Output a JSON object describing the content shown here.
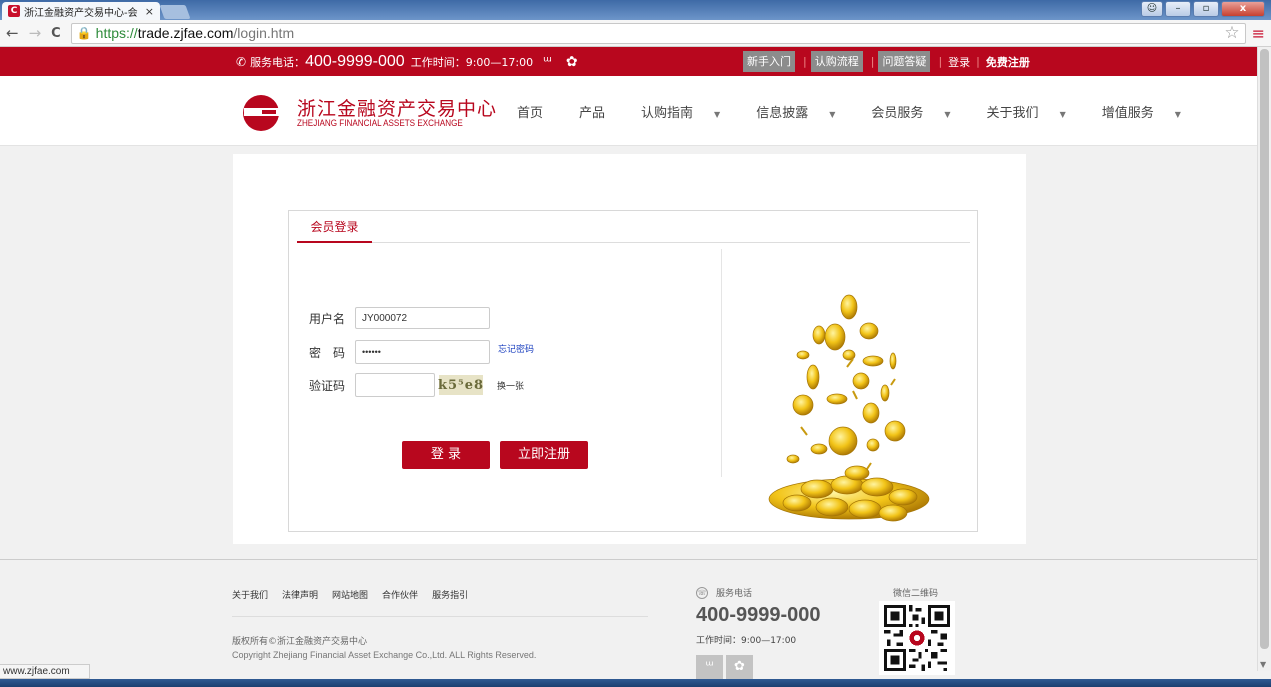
{
  "browser": {
    "tab_title": "浙江金融资产交易中心-会",
    "tab_close": "×",
    "favicon_letter": "C",
    "url_scheme": "https://",
    "url_host": "trade.zjfae.com",
    "url_path": "/login.htm",
    "status_url": "www.zjfae.com",
    "back_icon": "←",
    "forward_icon": "→",
    "reload_icon": "C",
    "star_icon": "☆",
    "menu_icon": "≡"
  },
  "topbar": {
    "hotline_label": "服务电话：",
    "hotline_number": "400-9999-000",
    "hours": "工作时间：9:00—17:00",
    "links": [
      "新手入门",
      "认购流程",
      "问题答疑"
    ],
    "login": "登录",
    "register": "免费注册"
  },
  "header": {
    "logo_cn": "浙江金融资产交易中心",
    "logo_en": "ZHEJIANG FINANCIAL ASSETS EXCHANGE",
    "nav": [
      {
        "label": "首页",
        "dropdown": false
      },
      {
        "label": "产品",
        "dropdown": false
      },
      {
        "label": "认购指南",
        "dropdown": true
      },
      {
        "label": "信息披露",
        "dropdown": true
      },
      {
        "label": "会员服务",
        "dropdown": true
      },
      {
        "label": "关于我们",
        "dropdown": true
      },
      {
        "label": "增值服务",
        "dropdown": true
      }
    ]
  },
  "login": {
    "tab": "会员登录",
    "username_label": "用户名",
    "username_value": "JY000072",
    "password_label": "密　码",
    "password_value": "••••••",
    "forgot": "忘记密码",
    "captcha_label": "验证码",
    "captcha_value": "",
    "captcha_image_text": "k5⁵e8",
    "refresh": "换一张",
    "login_button": "登 录",
    "register_button": "立即注册"
  },
  "footer": {
    "links": [
      "关于我们",
      "法律声明",
      "网站地图",
      "合作伙伴",
      "服务指引"
    ],
    "copyright_cn": "版权所有©浙江金融资产交易中心",
    "copyright_en": "Copyright Zhejiang Financial Asset Exchange Co.,Ltd. ALL Rights Reserved.",
    "service_label": "服务电话",
    "service_number": "400-9999-000",
    "service_hours": "工作时间：9:00—17:00",
    "qr_label": "微信二维码"
  },
  "colors": {
    "brand_red": "#b8071e",
    "link_blue": "#1a3fbf"
  }
}
